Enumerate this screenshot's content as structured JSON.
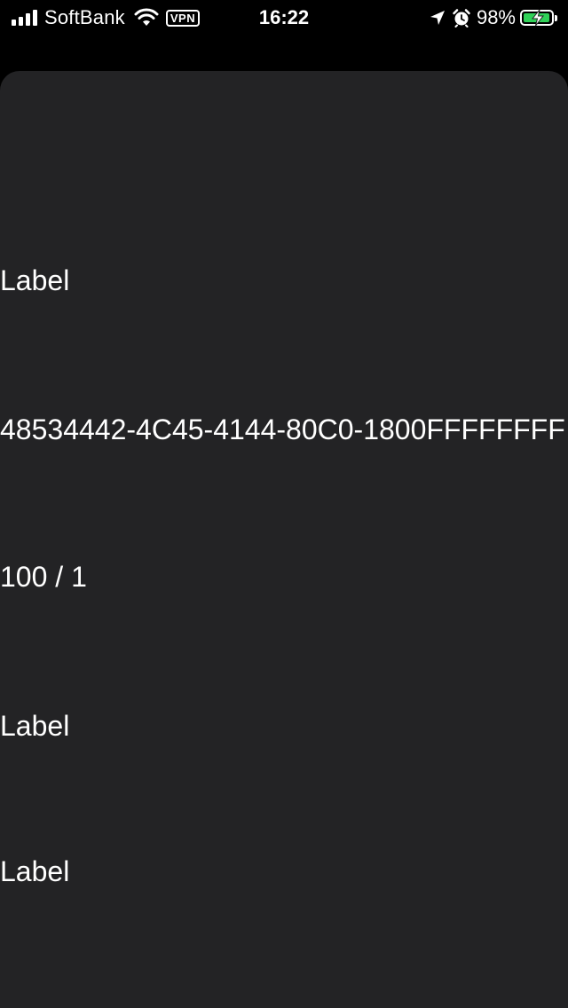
{
  "status_bar": {
    "carrier": "SoftBank",
    "vpn": "VPN",
    "time": "16:22",
    "battery_percent": "98%",
    "battery_level": 0.98,
    "battery_color": "#30d158",
    "icons": [
      "signal-icon",
      "wifi-icon",
      "vpn-icon",
      "location-arrow-icon",
      "alarm-icon",
      "battery-icon"
    ]
  },
  "sheet": {
    "background": "#232325",
    "rows": [
      {
        "text": "Label"
      },
      {
        "text": "48534442-4C45-4144-80C0-1800FFFFFFFF"
      },
      {
        "text": "100 / 1"
      },
      {
        "text": "Label"
      },
      {
        "text": "Label"
      }
    ]
  }
}
